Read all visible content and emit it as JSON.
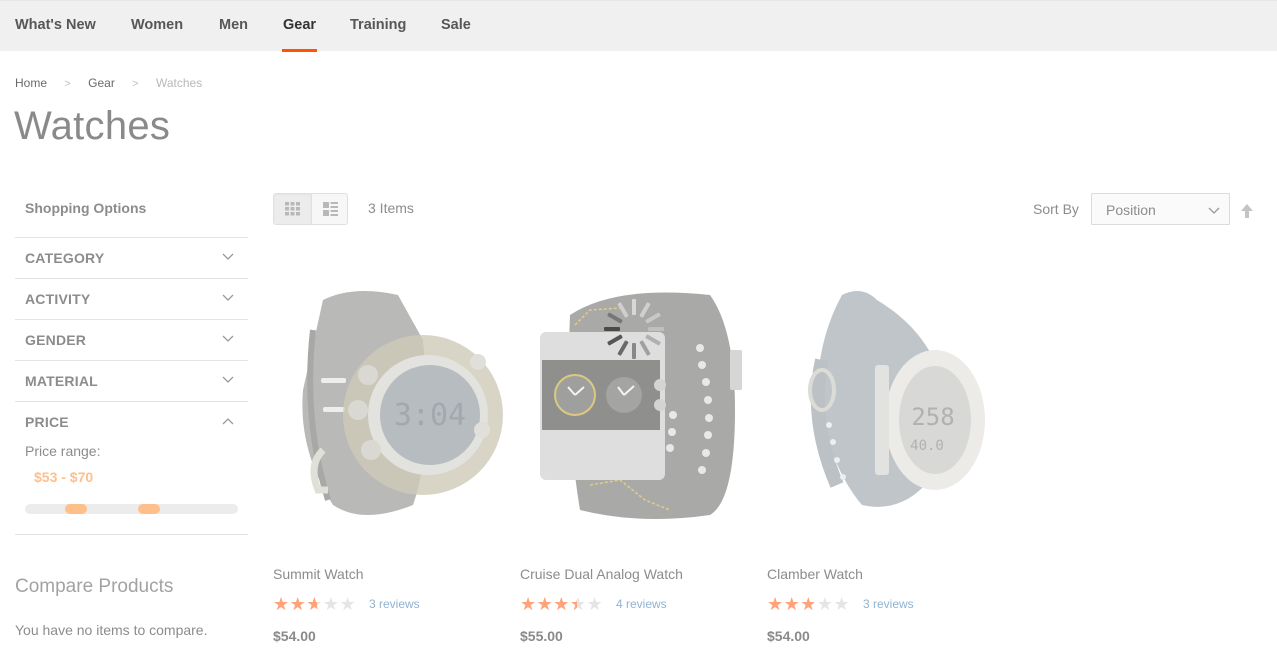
{
  "nav": {
    "items": [
      {
        "label": "What's New",
        "active": false
      },
      {
        "label": "Women",
        "active": false
      },
      {
        "label": "Men",
        "active": false
      },
      {
        "label": "Gear",
        "active": true
      },
      {
        "label": "Training",
        "active": false
      },
      {
        "label": "Sale",
        "active": false
      }
    ],
    "accent_color": "#ff5501"
  },
  "breadcrumb": [
    "Home",
    "Gear",
    "Watches"
  ],
  "page_title": "Watches",
  "sidebar": {
    "title": "Shopping Options",
    "filters": [
      {
        "label": "CATEGORY",
        "expanded": false
      },
      {
        "label": "ACTIVITY",
        "expanded": false
      },
      {
        "label": "GENDER",
        "expanded": false
      },
      {
        "label": "MATERIAL",
        "expanded": false
      },
      {
        "label": "PRICE",
        "expanded": true
      }
    ],
    "price": {
      "range_label": "Price range:",
      "range_value": "$53 - $70",
      "slider_min_fraction": 0.24,
      "slider_max_fraction": 0.58
    },
    "compare": {
      "title": "Compare Products",
      "empty_text": "You have no items to compare."
    }
  },
  "toolbar": {
    "modes": [
      {
        "name": "grid",
        "icon": "grid-icon",
        "active": true
      },
      {
        "name": "list",
        "icon": "list-icon",
        "active": false
      }
    ],
    "amount": "3 Items",
    "sort_label": "Sort By",
    "sort_value": "Position",
    "sort_direction_icon": "arrow-up-icon"
  },
  "products": [
    {
      "name": "Summit Watch",
      "rating_percent": 50,
      "reviews": "3 reviews",
      "price": "$54.00"
    },
    {
      "name": "Cruise Dual Analog Watch",
      "rating_percent": 65,
      "reviews": "4 reviews",
      "price": "$55.00"
    },
    {
      "name": "Clamber Watch",
      "rating_percent": 53,
      "reviews": "3 reviews",
      "price": "$54.00"
    }
  ],
  "stars_glyph": "★★★★★"
}
